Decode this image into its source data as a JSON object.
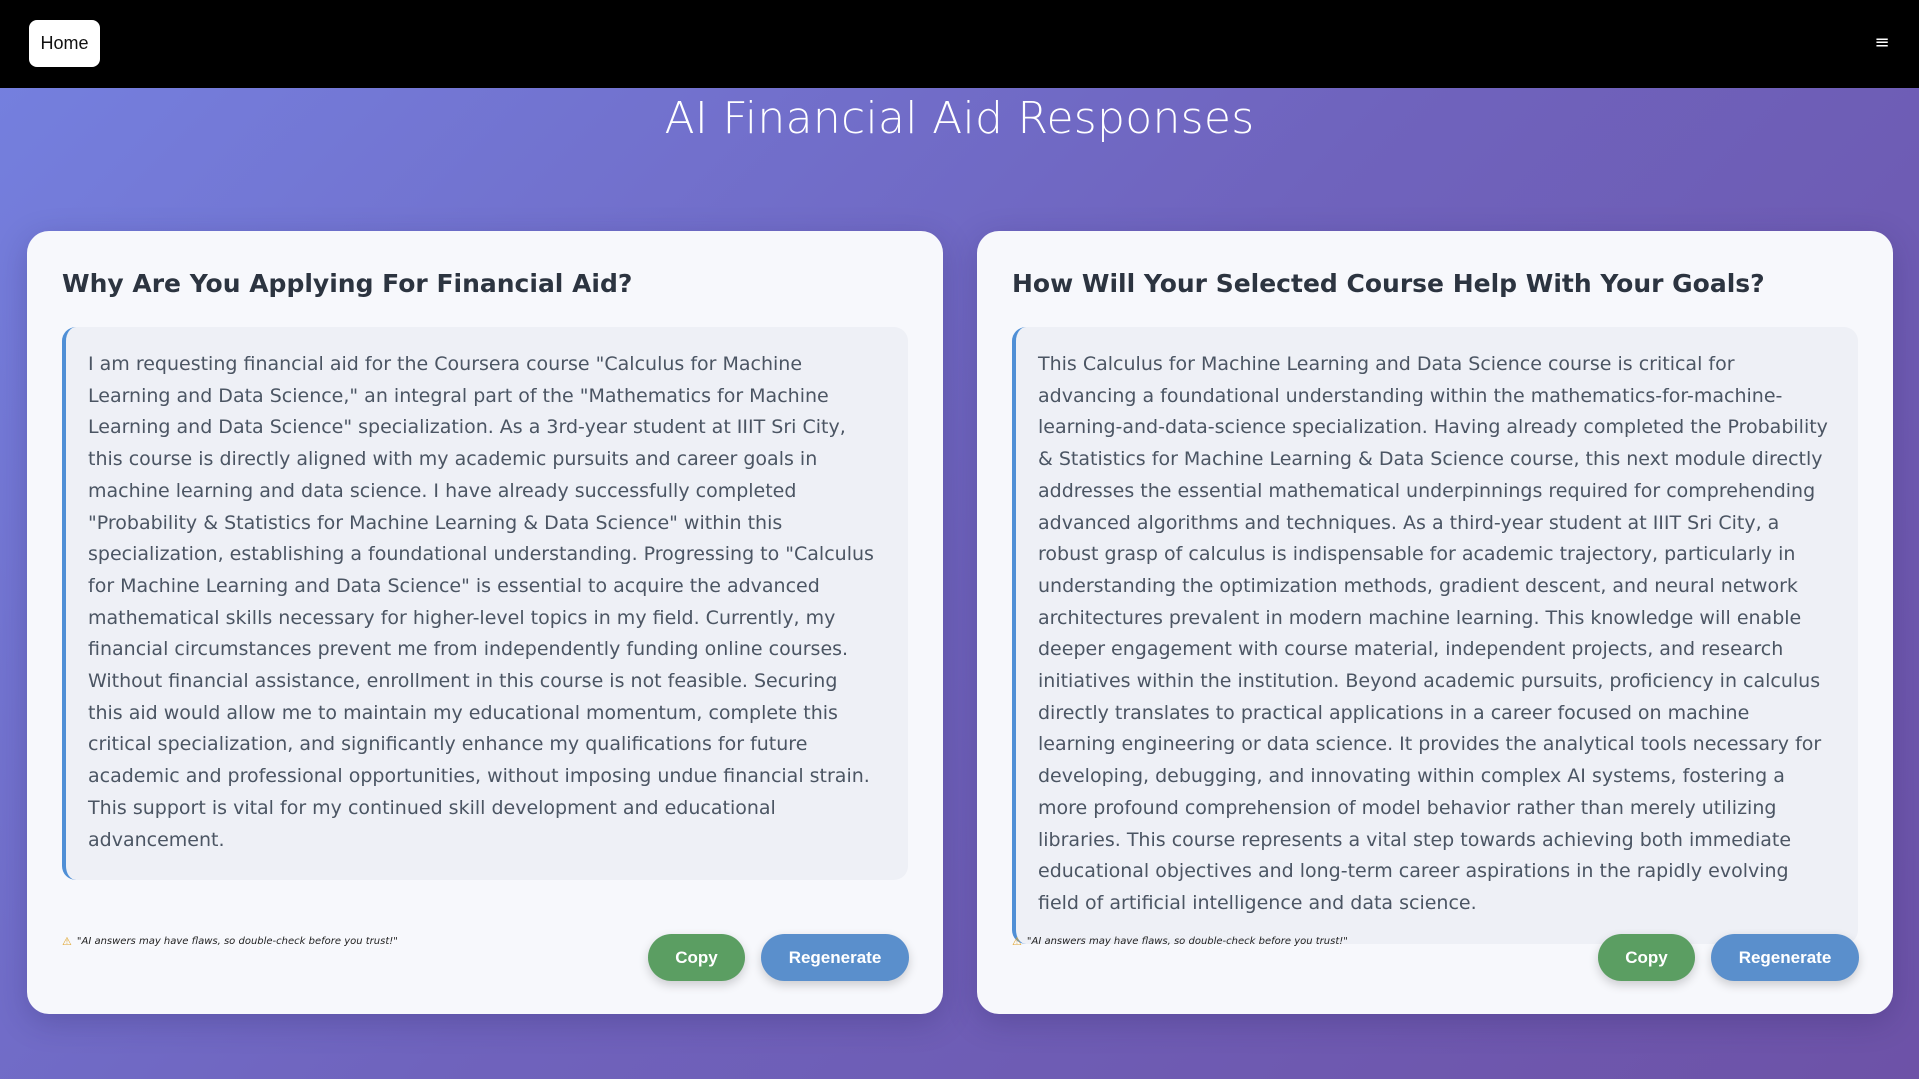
{
  "topbar": {
    "home_label": "Home",
    "menu_icon": "≡"
  },
  "page_title": "AI Financial Aid Responses",
  "cards": [
    {
      "heading": "Why Are You Applying For Financial Aid?",
      "response": "I am requesting financial aid for the Coursera course \"Calculus for Machine Learning and Data Science,\" an integral part of the \"Mathematics for Machine Learning and Data Science\" specialization. As a 3rd-year student at IIIT Sri City, this course is directly aligned with my academic pursuits and career goals in machine learning and data science. I have already successfully completed \"Probability & Statistics for Machine Learning & Data Science\" within this specialization, establishing a foundational understanding. Progressing to \"Calculus for Machine Learning and Data Science\" is essential to acquire the advanced mathematical skills necessary for higher-level topics in my field. Currently, my financial circumstances prevent me from independently funding online courses. Without financial assistance, enrollment in this course is not feasible. Securing this aid would allow me to maintain my educational momentum, complete this critical specialization, and significantly enhance my qualifications for future academic and professional opportunities, without imposing undue financial strain. This support is vital for my continued skill development and educational advancement.",
      "disclaimer": "\"AI answers may have flaws, so double-check before you trust!\"",
      "copy_label": "Copy",
      "regenerate_label": "Regenerate"
    },
    {
      "heading": "How Will Your Selected Course Help With Your Goals?",
      "response": "This Calculus for Machine Learning and Data Science course is critical for advancing a foundational understanding within the mathematics-for-machine-learning-and-data-science specialization. Having already completed the Probability & Statistics for Machine Learning & Data Science course, this next module directly addresses the essential mathematical underpinnings required for comprehending advanced algorithms and techniques. As a third-year student at IIIT Sri City, a robust grasp of calculus is indispensable for academic trajectory, particularly in understanding the optimization methods, gradient descent, and neural network architectures prevalent in modern machine learning. This knowledge will enable deeper engagement with course material, independent projects, and research initiatives within the institution. Beyond academic pursuits, proficiency in calculus directly translates to practical applications in a career focused on machine learning engineering or data science. It provides the analytical tools necessary for developing, debugging, and innovating within complex AI systems, fostering a more profound comprehension of model behavior rather than merely utilizing libraries. This course represents a vital step towards achieving both immediate educational objectives and long-term career aspirations in the rapidly evolving field of artificial intelligence and data science.",
      "disclaimer": "\"AI answers may have flaws, so double-check before you trust!\"",
      "copy_label": "Copy",
      "regenerate_label": "Regenerate"
    }
  ],
  "colors": {
    "copy_button": "#5b9e62",
    "regenerate_button": "#5a8fcc",
    "accent_border": "#4f8fd6"
  }
}
